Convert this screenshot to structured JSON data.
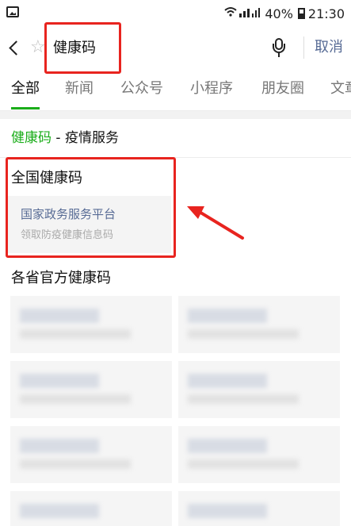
{
  "status_bar": {
    "network_icons": "☑ ▂▄▆",
    "battery_percent": "40%",
    "time": "21:30"
  },
  "search": {
    "query": "健康码",
    "cancel_label": "取消"
  },
  "tabs": [
    {
      "label": "全部",
      "active": true
    },
    {
      "label": "新闻",
      "active": false
    },
    {
      "label": "公众号",
      "active": false
    },
    {
      "label": "小程序",
      "active": false
    },
    {
      "label": "朋友圈",
      "active": false
    },
    {
      "label": "文章",
      "active": false
    }
  ],
  "section": {
    "keyword": "健康码",
    "rest": " - 疫情服务"
  },
  "national": {
    "title": "全国健康码",
    "platform_name": "国家政务服务平台",
    "platform_desc": "领取防疫健康信息码"
  },
  "provinces": {
    "title": "各省官方健康码"
  },
  "colors": {
    "accent_green": "#1aad19",
    "link_blue": "#576b95",
    "annotation_red": "#e8241f"
  }
}
